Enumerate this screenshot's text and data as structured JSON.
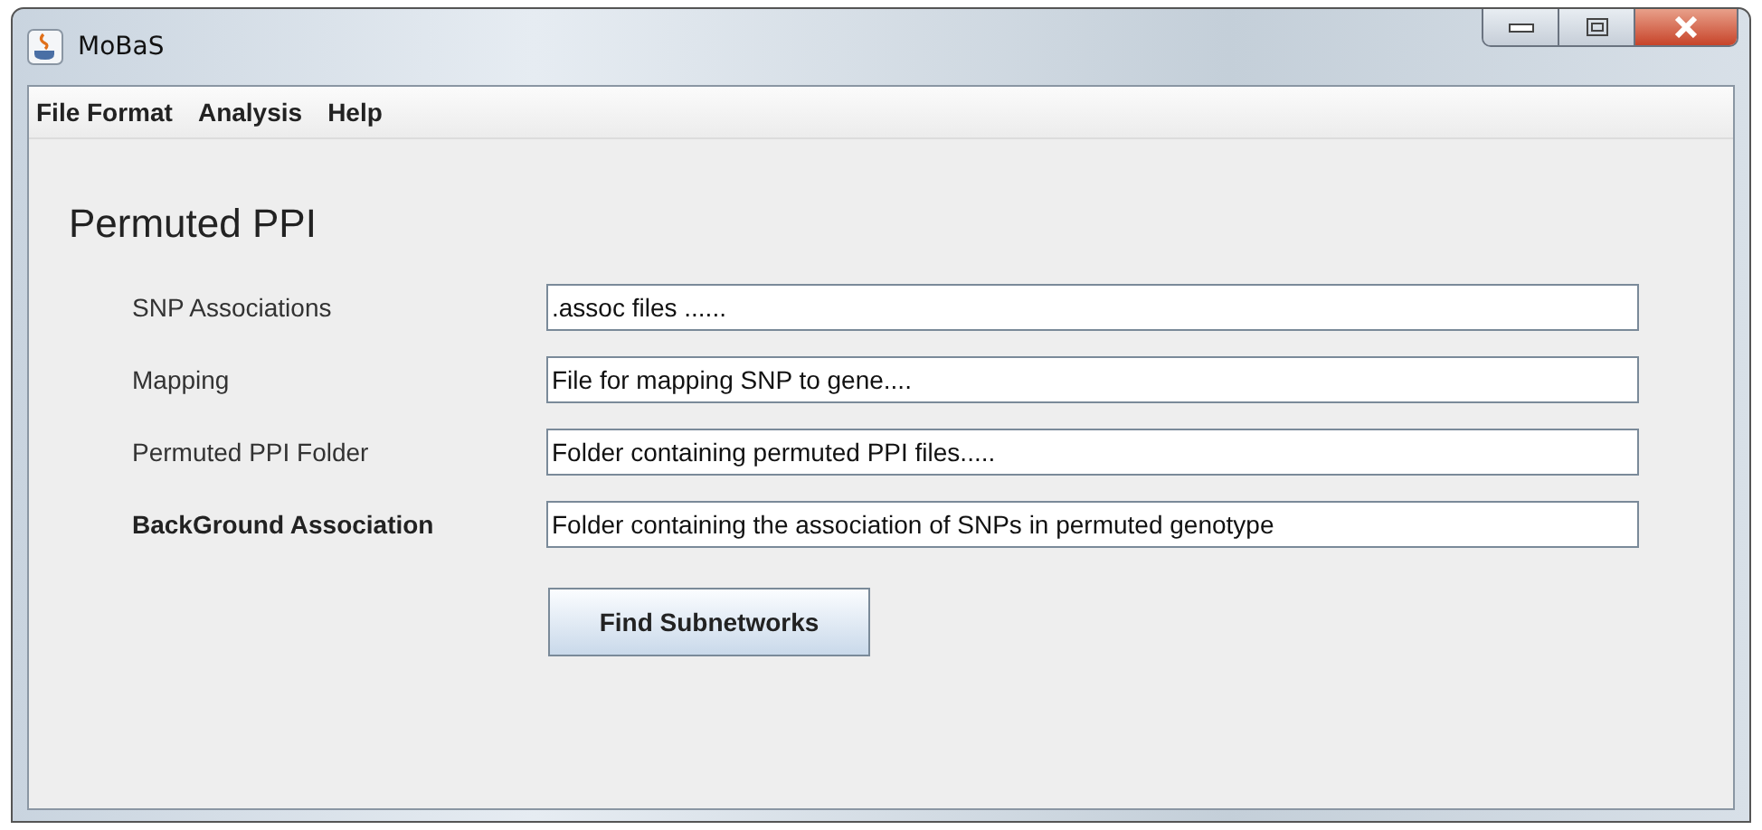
{
  "window": {
    "title": "MoBaS"
  },
  "menu": [
    "File Format",
    "Analysis",
    "Help"
  ],
  "heading": "Permuted PPI",
  "fields": [
    {
      "label": "SNP Associations",
      "value": ".assoc files ......",
      "emphasized": false
    },
    {
      "label": "Mapping",
      "value": "File for mapping SNP to gene....",
      "emphasized": false
    },
    {
      "label": "Permuted PPI Folder",
      "value": "Folder containing permuted PPI files.....",
      "emphasized": false
    },
    {
      "label": "BackGround Association",
      "value": "Folder containing the association of SNPs in permuted genotype",
      "emphasized": true
    }
  ],
  "buttons": [
    "Find Subnetworks"
  ]
}
